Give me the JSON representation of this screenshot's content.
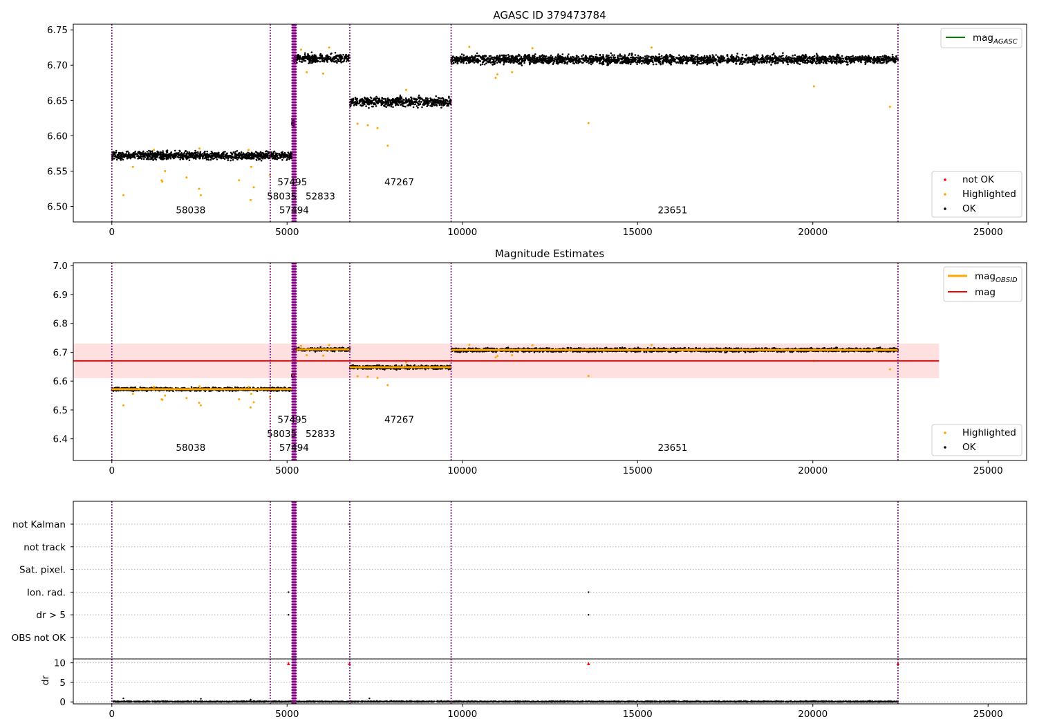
{
  "figure": {
    "background": "#ffffff"
  },
  "colors": {
    "ok": "#000000",
    "highlighted": "#ffa500",
    "not_ok": "#ff0000",
    "mag_agasc": "#008000",
    "mag_obsid": "#ffa500",
    "mag": "#ff0000",
    "mag_band": "#ffcccc",
    "obs_boundary": "#800080",
    "grid": "#b0b0b0"
  },
  "chart_data": [
    {
      "type": "scatter",
      "title": "AGASC ID 379473784",
      "xlabel": "",
      "ylabel": "",
      "xlim": [
        -1100,
        26100
      ],
      "ylim": [
        6.478,
        6.758
      ],
      "xticks": [
        0,
        5000,
        10000,
        15000,
        20000,
        25000
      ],
      "xticklabels": [
        "0",
        "5000",
        "10000",
        "15000",
        "20000",
        "25000"
      ],
      "yticks": [
        6.5,
        6.55,
        6.6,
        6.65,
        6.7,
        6.75
      ],
      "yticklabels": [
        "6.50",
        "6.55",
        "6.60",
        "6.65",
        "6.70",
        "6.75"
      ],
      "legend_upper": {
        "placement": "top-right",
        "entries": [
          {
            "label": "mag",
            "sub": "AGASC",
            "kind": "line",
            "color_key": "mag_agasc"
          }
        ]
      },
      "legend_lower": {
        "placement": "bottom-right",
        "entries": [
          {
            "label": "not OK",
            "kind": "dot",
            "color_key": "not_ok"
          },
          {
            "label": "Highlighted",
            "kind": "dot",
            "color_key": "highlighted"
          },
          {
            "label": "OK",
            "kind": "dot",
            "color_key": "ok"
          }
        ]
      },
      "obs_labels": [
        {
          "text": "57495",
          "x": 5150,
          "y": 6.53
        },
        {
          "text": "58035",
          "x": 4850,
          "y": 6.51
        },
        {
          "text": "52833",
          "x": 5950,
          "y": 6.51
        },
        {
          "text": "47267",
          "x": 8200,
          "y": 6.53
        },
        {
          "text": "58038",
          "x": 2250,
          "y": 6.49
        },
        {
          "text": "57494",
          "x": 5200,
          "y": 6.49
        },
        {
          "text": "23651",
          "x": 16000,
          "y": 6.49
        }
      ]
    },
    {
      "type": "scatter",
      "title": "Magnitude Estimates",
      "xlabel": "",
      "ylabel": "",
      "xlim": [
        -1100,
        26100
      ],
      "ylim": [
        6.325,
        7.01
      ],
      "xticks": [
        0,
        5000,
        10000,
        15000,
        20000,
        25000
      ],
      "xticklabels": [
        "0",
        "5000",
        "10000",
        "15000",
        "20000",
        "25000"
      ],
      "yticks": [
        6.4,
        6.5,
        6.6,
        6.7,
        6.8,
        6.9,
        7.0
      ],
      "yticklabels": [
        "6.4",
        "6.5",
        "6.6",
        "6.7",
        "6.8",
        "6.9",
        "7.0"
      ],
      "mag": {
        "value": 6.67,
        "band": [
          6.61,
          6.73
        ],
        "x_range": [
          -1100,
          23600
        ]
      },
      "legend_upper": {
        "placement": "top-right",
        "entries": [
          {
            "label": "mag",
            "sub": "OBSID",
            "kind": "thickline",
            "color_key": "mag_obsid"
          },
          {
            "label": "mag",
            "kind": "line",
            "color_key": "mag"
          }
        ]
      },
      "legend_lower": {
        "placement": "bottom-right",
        "entries": [
          {
            "label": "Highlighted",
            "kind": "dot",
            "color_key": "highlighted"
          },
          {
            "label": "OK",
            "kind": "dot",
            "color_key": "ok"
          }
        ]
      },
      "obs_labels": [
        {
          "text": "57495",
          "x": 5150,
          "y": 6.455
        },
        {
          "text": "58035",
          "x": 4850,
          "y": 6.407
        },
        {
          "text": "52833",
          "x": 5950,
          "y": 6.407
        },
        {
          "text": "47267",
          "x": 8200,
          "y": 6.455
        },
        {
          "text": "58038",
          "x": 2250,
          "y": 6.359
        },
        {
          "text": "57494",
          "x": 5200,
          "y": 6.359
        },
        {
          "text": "23651",
          "x": 16000,
          "y": 6.359
        }
      ]
    },
    {
      "type": "scatter",
      "title": "",
      "xlabel": "",
      "xlim": [
        -1100,
        26100
      ],
      "xticks": [
        0,
        5000,
        10000,
        15000,
        20000,
        25000
      ],
      "xticklabels": [
        "0",
        "5000",
        "10000",
        "15000",
        "20000",
        "25000"
      ],
      "flag_rows": [
        "not Kalman",
        "not track",
        "Sat. pixel.",
        "Ion. rad.",
        "dr > 5",
        "OBS not OK"
      ],
      "flag_points": [
        {
          "flag": "Ion. rad.",
          "x": 5040
        },
        {
          "flag": "Ion. rad.",
          "x": 13600
        },
        {
          "flag": "dr > 5",
          "x": 5040
        },
        {
          "flag": "dr > 5",
          "x": 13600
        },
        {
          "flag": "not Kalman",
          "x": 6780
        }
      ],
      "dr": {
        "ylabel": "dr",
        "ylim": [
          -0.5,
          11
        ],
        "yticks": [
          0,
          5,
          10
        ],
        "yticklabels": [
          "0",
          "5",
          "10"
        ],
        "clipped_points_x": [
          5040,
          6780,
          13600,
          22430
        ]
      }
    }
  ],
  "observations": [
    {
      "obsid": "58038",
      "start": 0,
      "end": 4520,
      "mag": 6.572,
      "spread": 0.0055
    },
    {
      "obsid": "58035",
      "start": 4520,
      "end": 5140,
      "mag": 6.572,
      "spread": 0.006
    },
    {
      "obsid": "57494",
      "start": 5140,
      "end": 5200,
      "mag": 6.618,
      "spread": 0.005
    },
    {
      "obsid": "57495",
      "start": 5200,
      "end": 5260,
      "mag": 6.708,
      "spread": 0.005
    },
    {
      "obsid": "52833",
      "start": 5260,
      "end": 6790,
      "mag": 6.71,
      "spread": 0.0055
    },
    {
      "obsid": "47267",
      "start": 6790,
      "end": 9680,
      "mag": 6.648,
      "spread": 0.0065
    },
    {
      "obsid": "23651",
      "start": 9680,
      "end": 22430,
      "mag": 6.708,
      "spread": 0.006
    }
  ],
  "obs_boundaries": [
    0,
    4520,
    5140,
    5160,
    5180,
    5200,
    5220,
    5240,
    5260,
    6790,
    9680,
    22430
  ],
  "highlighted_points": [
    [
      330,
      6.516
    ],
    [
      600,
      6.556
    ],
    [
      1420,
      6.537
    ],
    [
      1440,
      6.535
    ],
    [
      1520,
      6.55
    ],
    [
      2130,
      6.541
    ],
    [
      2490,
      6.525
    ],
    [
      2540,
      6.516
    ],
    [
      3630,
      6.537
    ],
    [
      3960,
      6.509
    ],
    [
      4050,
      6.527
    ],
    [
      3980,
      6.556
    ],
    [
      4510,
      6.545
    ],
    [
      5560,
      6.69
    ],
    [
      6030,
      6.688
    ],
    [
      7010,
      6.617
    ],
    [
      7300,
      6.615
    ],
    [
      7580,
      6.611
    ],
    [
      7870,
      6.586
    ],
    [
      10950,
      6.682
    ],
    [
      11000,
      6.687
    ],
    [
      11420,
      6.69
    ],
    [
      13600,
      6.618
    ],
    [
      20030,
      6.67
    ],
    [
      22200,
      6.641
    ],
    [
      1200,
      6.58
    ],
    [
      2500,
      6.582
    ],
    [
      3900,
      6.58
    ],
    [
      5400,
      6.722
    ],
    [
      6200,
      6.725
    ],
    [
      8400,
      6.665
    ],
    [
      10200,
      6.726
    ],
    [
      12000,
      6.724
    ],
    [
      15400,
      6.725
    ]
  ]
}
